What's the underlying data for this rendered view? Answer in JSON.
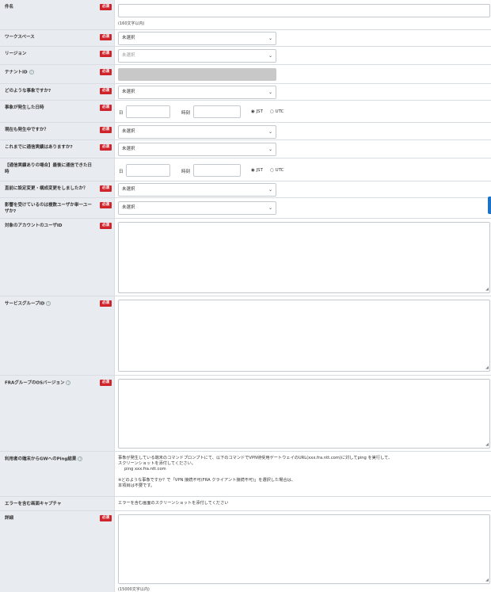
{
  "required_badge": "必須",
  "help_icon": "?",
  "fields": {
    "subject": {
      "label": "件名",
      "hint": "(160文字以内)"
    },
    "workspace": {
      "label": "ワークスペース",
      "value": "未選択"
    },
    "region": {
      "label": "リージョン",
      "value": "未選択"
    },
    "tenant": {
      "label": "テナントID"
    },
    "event_type": {
      "label": "どのような事象ですか?",
      "value": "未選択"
    },
    "occurred_at": {
      "label": "事象が発生した日時",
      "date_label": "日",
      "time_label": "時刻",
      "tz_jst": "JST",
      "tz_utc": "UTC",
      "selected_tz": "JST"
    },
    "ongoing": {
      "label": "現在も発生中ですか？",
      "value": "未選択"
    },
    "comm_history": {
      "label": "これまでに通信実績はありますか?",
      "value": "未選択"
    },
    "last_comm": {
      "label": "【通信実績ありの場合】最後に通信できた日時",
      "date_label": "日",
      "time_label": "時刻",
      "tz_jst": "JST",
      "tz_utc": "UTC",
      "selected_tz": "JST"
    },
    "config_change": {
      "label": "直前に設定変更・構成変更をしましたか？",
      "value": "未選択"
    },
    "affected_users": {
      "label": "影響を受けているのは複数ユーザか単一ユーザか?",
      "value": "未選択"
    },
    "account_user_id": {
      "label": "対象のアカウントのユーザID"
    },
    "service_group_id": {
      "label": "サービスグループID"
    },
    "fra_os_version": {
      "label": "FRAグループのOSバージョン"
    },
    "ping_result": {
      "label": "利用者の端末からGWへのPing結果",
      "line1": "事象が発生している端末のコマンドプロンプトにて、以下のコマンドでVPN待受用ゲートウェイのURL(xxx.fra.ntt.com)に対してping を実行して、",
      "line2": "スクリーンショットを添付してください。",
      "line3": "ping xxx.fra.ntt.com",
      "line4": "※どのような事象ですか？で「VPN 接続不可(FRA クライアント接続不可)」を選択した場合は、",
      "line5": "本項目は不要です。"
    },
    "error_screenshot": {
      "label": "エラーを含む画面キャプチャ",
      "text": "エラーを含む画面のスクリーンショットを添付してください"
    },
    "details": {
      "label": "詳細",
      "hint": "(15000文字以内)"
    }
  },
  "colors": {
    "required": "#d0242d",
    "label_bg": "#e8ebef",
    "accent": "#1a73c8"
  }
}
